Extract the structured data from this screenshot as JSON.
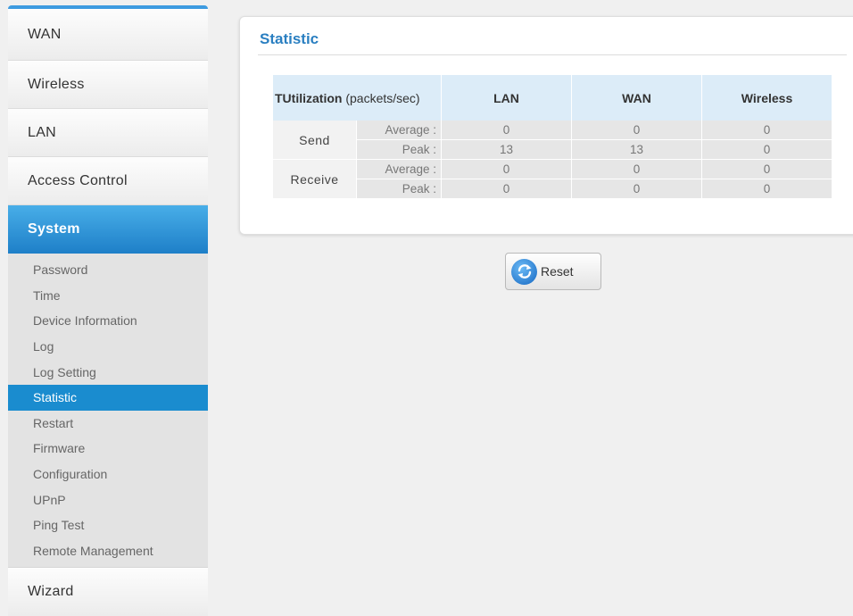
{
  "sidebar": {
    "top_items": [
      {
        "label": "WAN"
      },
      {
        "label": "Wireless"
      },
      {
        "label": "LAN"
      },
      {
        "label": "Access Control"
      }
    ],
    "active_section": "System",
    "submenu": [
      {
        "label": "Password"
      },
      {
        "label": "Time"
      },
      {
        "label": "Device Information"
      },
      {
        "label": "Log"
      },
      {
        "label": "Log Setting"
      },
      {
        "label": "Statistic"
      },
      {
        "label": "Restart"
      },
      {
        "label": "Firmware"
      },
      {
        "label": "Configuration"
      },
      {
        "label": "UPnP"
      },
      {
        "label": "Ping Test"
      },
      {
        "label": "Remote Management"
      }
    ],
    "active_submenu": "Statistic",
    "bottom_item": "Wizard"
  },
  "main": {
    "title": "Statistic",
    "table": {
      "header_bold": "TUtilization",
      "header_unit": "(packets/sec)",
      "columns": [
        "LAN",
        "WAN",
        "Wireless"
      ],
      "groups": [
        {
          "name": "Send",
          "rows": [
            {
              "metric": "Average :",
              "values": [
                "0",
                "0",
                "0"
              ]
            },
            {
              "metric": "Peak :",
              "values": [
                "13",
                "13",
                "0"
              ]
            }
          ]
        },
        {
          "name": "Receive",
          "rows": [
            {
              "metric": "Average :",
              "values": [
                "0",
                "0",
                "0"
              ]
            },
            {
              "metric": "Peak :",
              "values": [
                "0",
                "0",
                "0"
              ]
            }
          ]
        }
      ]
    },
    "reset_label": "Reset"
  },
  "icons": {
    "reset": "refresh-icon"
  },
  "colors": {
    "accent": "#1a8ccf",
    "title": "#2a7fc1",
    "header_bg": "#dcecf8"
  }
}
